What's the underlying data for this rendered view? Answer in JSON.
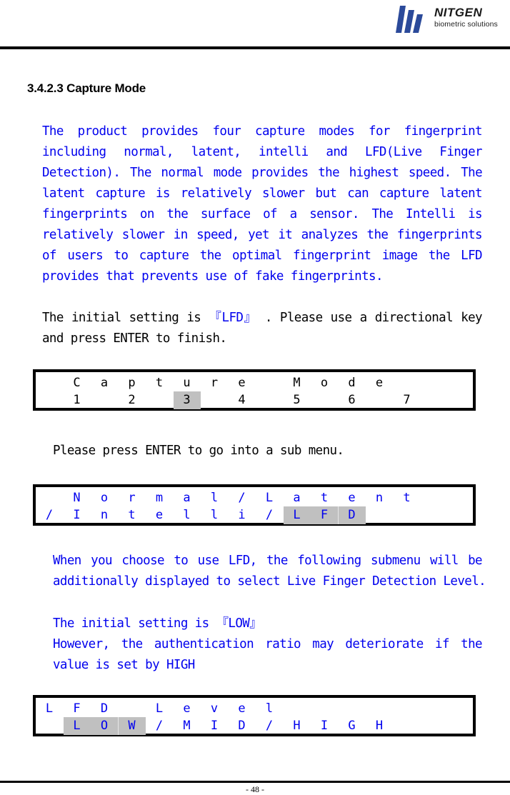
{
  "header": {
    "brand_name": "NITGEN",
    "brand_tagline": "biometric solutions",
    "logo_color": "#2b4a9a"
  },
  "section": {
    "heading": "3.4.2.3 Capture Mode"
  },
  "paragraphs": {
    "intro": [
      "The product provides four capture modes for fingerprint",
      "including normal, latent, intelli and LFD(Live Finger",
      "Detection). The normal mode provides the highest speed. The",
      "latent capture is relatively slower but can capture latent",
      "fingerprints on the surface of a sensor. The Intelli is",
      "relatively slower in speed, yet it analyzes the fingerprints",
      "of users to capture the optimal fingerprint image the LFD",
      "provides that prevents use of fake fingerprints."
    ],
    "initial_setting": {
      "prefix": "The initial setting is ",
      "value": "『LFD』",
      "suffix": " . Please use a directional key",
      "line2": "and press ENTER to finish."
    },
    "submenu_hint": "Please press ENTER to go into a sub menu.",
    "lfd_note": [
      "When you choose to use LFD, the following submenu will be",
      "additionally displayed to select Live Finger Detection Level."
    ],
    "lfd_initial": {
      "prefix": "The initial setting is ",
      "value": "『LOW』",
      "line2": "However, the authentication ratio may deteriorate if the",
      "line3": "value is set by HIGH"
    }
  },
  "lcd_screens": [
    {
      "name": "capture-mode-screen",
      "color": "black",
      "rows": [
        {
          "cells": [
            {
              "col": 1,
              "ch": "C"
            },
            {
              "col": 2,
              "ch": "a"
            },
            {
              "col": 3,
              "ch": "p"
            },
            {
              "col": 4,
              "ch": "t"
            },
            {
              "col": 5,
              "ch": "u"
            },
            {
              "col": 6,
              "ch": "r"
            },
            {
              "col": 7,
              "ch": "e"
            },
            {
              "col": 9,
              "ch": "M"
            },
            {
              "col": 10,
              "ch": "o"
            },
            {
              "col": 11,
              "ch": "d"
            },
            {
              "col": 12,
              "ch": "e"
            }
          ]
        },
        {
          "cells": [
            {
              "col": 1,
              "ch": "1"
            },
            {
              "col": 3,
              "ch": "2"
            },
            {
              "col": 5,
              "ch": "3",
              "selected": true
            },
            {
              "col": 7,
              "ch": "4"
            },
            {
              "col": 9,
              "ch": "5"
            },
            {
              "col": 11,
              "ch": "6"
            },
            {
              "col": 13,
              "ch": "7"
            }
          ]
        }
      ]
    },
    {
      "name": "capture-type-screen",
      "color": "blue",
      "rows": [
        {
          "cells": [
            {
              "col": 1,
              "ch": "N"
            },
            {
              "col": 2,
              "ch": "o"
            },
            {
              "col": 3,
              "ch": "r"
            },
            {
              "col": 4,
              "ch": "m"
            },
            {
              "col": 5,
              "ch": "a"
            },
            {
              "col": 6,
              "ch": "l"
            },
            {
              "col": 7,
              "ch": "/"
            },
            {
              "col": 8,
              "ch": "L"
            },
            {
              "col": 9,
              "ch": "a"
            },
            {
              "col": 10,
              "ch": "t"
            },
            {
              "col": 11,
              "ch": "e"
            },
            {
              "col": 12,
              "ch": "n"
            },
            {
              "col": 13,
              "ch": "t"
            }
          ]
        },
        {
          "cells": [
            {
              "col": 0,
              "ch": "/"
            },
            {
              "col": 1,
              "ch": "I"
            },
            {
              "col": 2,
              "ch": "n"
            },
            {
              "col": 3,
              "ch": "t"
            },
            {
              "col": 4,
              "ch": "e"
            },
            {
              "col": 5,
              "ch": "l"
            },
            {
              "col": 6,
              "ch": "l"
            },
            {
              "col": 7,
              "ch": "i"
            },
            {
              "col": 8,
              "ch": "/"
            },
            {
              "col": 9,
              "ch": "L",
              "selected": true
            },
            {
              "col": 10,
              "ch": "F",
              "selected": true
            },
            {
              "col": 11,
              "ch": "D",
              "selected": true
            }
          ]
        }
      ]
    },
    {
      "name": "lfd-level-screen",
      "color": "blue",
      "rows": [
        {
          "cells": [
            {
              "col": 0,
              "ch": "L"
            },
            {
              "col": 1,
              "ch": "F"
            },
            {
              "col": 2,
              "ch": "D"
            },
            {
              "col": 4,
              "ch": "L"
            },
            {
              "col": 5,
              "ch": "e"
            },
            {
              "col": 6,
              "ch": "v"
            },
            {
              "col": 7,
              "ch": "e"
            },
            {
              "col": 8,
              "ch": "l"
            }
          ]
        },
        {
          "cells": [
            {
              "col": 1,
              "ch": "L",
              "selected": true
            },
            {
              "col": 2,
              "ch": "O",
              "selected": true
            },
            {
              "col": 3,
              "ch": "W",
              "selected": true
            },
            {
              "col": 4,
              "ch": "/"
            },
            {
              "col": 5,
              "ch": "M"
            },
            {
              "col": 6,
              "ch": "I"
            },
            {
              "col": 7,
              "ch": "D"
            },
            {
              "col": 8,
              "ch": "/"
            },
            {
              "col": 9,
              "ch": "H"
            },
            {
              "col": 10,
              "ch": "I"
            },
            {
              "col": 11,
              "ch": "G"
            },
            {
              "col": 12,
              "ch": "H"
            }
          ]
        }
      ]
    }
  ],
  "footer": {
    "page_number": "- 48 -"
  }
}
